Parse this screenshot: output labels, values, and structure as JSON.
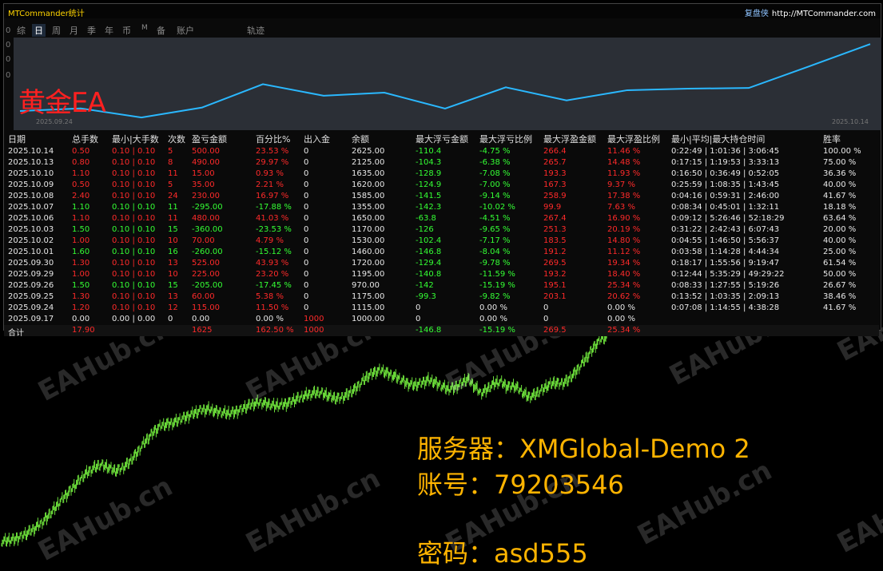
{
  "app_title": "MTCommander统计",
  "brand": {
    "name": "复盘侠",
    "site": "http://MTCommander.com"
  },
  "tabs": [
    "综",
    "日",
    "周",
    "月",
    "季",
    "年",
    "币",
    "M",
    "备",
    "账户",
    "轨迹"
  ],
  "active_tab": "日",
  "left_axis_labels": [
    "0",
    "0",
    "0",
    "0"
  ],
  "equity_label": "黄金EA",
  "equity_start_date": "2025.09.24",
  "equity_end_date": "2025.10.14",
  "equity_curve": [
    1115,
    1175,
    970,
    1195,
    1720,
    1460,
    1530,
    1170,
    1650,
    1355,
    1585,
    1620,
    1635,
    2125,
    2625
  ],
  "equity_range": [
    900,
    2700
  ],
  "colors": {
    "line": "#2ab8ff",
    "loss": "#ff2a2a",
    "profit": "#34ff34",
    "accent": "#ffd400"
  },
  "table": {
    "headers": [
      "日期",
      "总手数",
      "最小|大手数",
      "次数",
      "盈亏金额",
      "百分比%",
      "出入金",
      "余额",
      "最大浮亏金额",
      "最大浮亏比例",
      "最大浮盈金额",
      "最大浮盈比例",
      "最小|平均|最大持仓时间",
      "胜率"
    ],
    "rows": [
      [
        "2025.10.14",
        "0.50",
        "0.10 | 0.10",
        "5",
        "500.00",
        "23.53 %",
        "0",
        "2625.00",
        "-110.4",
        "-4.75 %",
        "266.4",
        "11.46 %",
        "0:22:49 | 1:01:36 | 3:06:45",
        "100.00 %"
      ],
      [
        "2025.10.13",
        "0.80",
        "0.10 | 0.10",
        "8",
        "490.00",
        "29.97 %",
        "0",
        "2125.00",
        "-104.3",
        "-6.38 %",
        "265.7",
        "14.48 %",
        "0:17:15 | 1:19:53 | 3:33:13",
        "75.00 %"
      ],
      [
        "2025.10.10",
        "1.10",
        "0.10 | 0.10",
        "11",
        "15.00",
        "0.93 %",
        "0",
        "1635.00",
        "-128.9",
        "-7.08 %",
        "193.3",
        "11.93 %",
        "0:16:50 | 0:36:49 | 0:52:05",
        "36.36 %"
      ],
      [
        "2025.10.09",
        "0.50",
        "0.10 | 0.10",
        "5",
        "35.00",
        "2.21 %",
        "0",
        "1620.00",
        "-124.9",
        "-7.00 %",
        "167.3",
        "9.37 %",
        "0:25:59 | 1:08:35 | 1:43:45",
        "40.00 %"
      ],
      [
        "2025.10.08",
        "2.40",
        "0.10 | 0.10",
        "24",
        "230.00",
        "16.97 %",
        "0",
        "1585.00",
        "-141.5",
        "-9.14 %",
        "258.9",
        "17.38 %",
        "0:04:16 | 0:59:31 | 2:46:00",
        "41.67 %"
      ],
      [
        "2025.10.07",
        "1.10",
        "0.10 | 0.10",
        "11",
        "-295.00",
        "-17.88 %",
        "0",
        "1355.00",
        "-142.3",
        "-10.02 %",
        "99.9",
        "7.63 %",
        "0:08:34 | 0:45:01 | 1:32:11",
        "18.18 %"
      ],
      [
        "2025.10.06",
        "1.10",
        "0.10 | 0.10",
        "11",
        "480.00",
        "41.03 %",
        "0",
        "1650.00",
        "-63.8",
        "-4.51 %",
        "267.4",
        "16.90 %",
        "0:09:12 | 5:26:46 | 52:18:29",
        "63.64 %"
      ],
      [
        "2025.10.03",
        "1.50",
        "0.10 | 0.10",
        "15",
        "-360.00",
        "-23.53 %",
        "0",
        "1170.00",
        "-126",
        "-9.65 %",
        "251.3",
        "20.19 %",
        "0:31:22 | 2:42:43 | 6:07:43",
        "20.00 %"
      ],
      [
        "2025.10.02",
        "1.00",
        "0.10 | 0.10",
        "10",
        "70.00",
        "4.79 %",
        "0",
        "1530.00",
        "-102.4",
        "-7.17 %",
        "183.5",
        "14.80 %",
        "0:04:55 | 1:46:50 | 5:56:37",
        "40.00 %"
      ],
      [
        "2025.10.01",
        "1.60",
        "0.10 | 0.10",
        "16",
        "-260.00",
        "-15.12 %",
        "0",
        "1460.00",
        "-146.8",
        "-8.04 %",
        "191.2",
        "11.12 %",
        "0:03:58 | 1:14:28 | 4:44:34",
        "25.00 %"
      ],
      [
        "2025.09.30",
        "1.30",
        "0.10 | 0.10",
        "13",
        "525.00",
        "43.93 %",
        "0",
        "1720.00",
        "-129.4",
        "-9.78 %",
        "269.5",
        "19.34 %",
        "0:18:17 | 1:55:56 | 9:19:47",
        "61.54 %"
      ],
      [
        "2025.09.29",
        "1.00",
        "0.10 | 0.10",
        "10",
        "225.00",
        "23.20 %",
        "0",
        "1195.00",
        "-140.8",
        "-11.59 %",
        "193.2",
        "18.40 %",
        "0:12:44 | 5:35:29 | 49:29:22",
        "50.00 %"
      ],
      [
        "2025.09.26",
        "1.50",
        "0.10 | 0.10",
        "15",
        "-205.00",
        "-17.45 %",
        "0",
        "970.00",
        "-142",
        "-15.19 %",
        "195.1",
        "25.34 %",
        "0:08:33 | 1:27:55 | 5:19:26",
        "26.67 %"
      ],
      [
        "2025.09.25",
        "1.30",
        "0.10 | 0.10",
        "13",
        "60.00",
        "5.38 %",
        "0",
        "1175.00",
        "-99.3",
        "-9.82 %",
        "203.1",
        "20.62 %",
        "0:13:52 | 1:03:35 | 2:09:13",
        "38.46 %"
      ],
      [
        "2025.09.24",
        "1.20",
        "0.10 | 0.10",
        "12",
        "115.00",
        "11.50 %",
        "0",
        "1115.00",
        "0",
        "0.00 %",
        "0",
        "0.00 %",
        "0:07:08 | 1:14:55 | 4:38:28",
        "41.67 %"
      ],
      [
        "2025.09.17",
        "0.00",
        "0.00 | 0.00",
        "0",
        "0.00",
        "0.00 %",
        "1000",
        "1000.00",
        "0",
        "0.00 %",
        "0",
        "0.00 %",
        "",
        ""
      ]
    ],
    "total": [
      "合计",
      "17.90",
      "",
      "",
      "1625",
      "162.50 %",
      "1000",
      "",
      "-146.8",
      "-15.19 %",
      "269.5",
      "25.34 %",
      "",
      ""
    ]
  },
  "price_series": [
    20,
    22,
    25,
    31,
    38,
    47,
    58,
    72,
    88,
    105,
    120,
    135,
    150,
    163,
    172,
    178,
    172,
    165,
    170,
    180,
    196,
    215,
    232,
    248,
    258,
    262,
    265,
    272,
    278,
    284,
    290,
    292,
    288,
    285,
    283,
    286,
    292,
    298,
    304,
    306,
    302,
    299,
    300,
    304,
    311,
    316,
    322,
    325,
    326,
    320,
    314,
    316,
    322,
    332,
    346,
    360,
    368,
    372,
    366,
    360,
    352,
    345,
    341,
    345,
    352,
    348,
    340,
    333,
    336,
    345,
    354,
    340,
    325,
    333,
    345,
    348,
    338,
    340,
    330,
    318,
    320,
    330,
    340,
    346,
    345,
    350,
    365,
    382,
    400,
    420,
    436,
    440
  ],
  "price_range": [
    0,
    460
  ],
  "watermark": "EAHub.cn",
  "info": {
    "server": "服务器：XMGlobal-Demo 2",
    "account": "账号：79203546",
    "password": "密码：asd555"
  }
}
